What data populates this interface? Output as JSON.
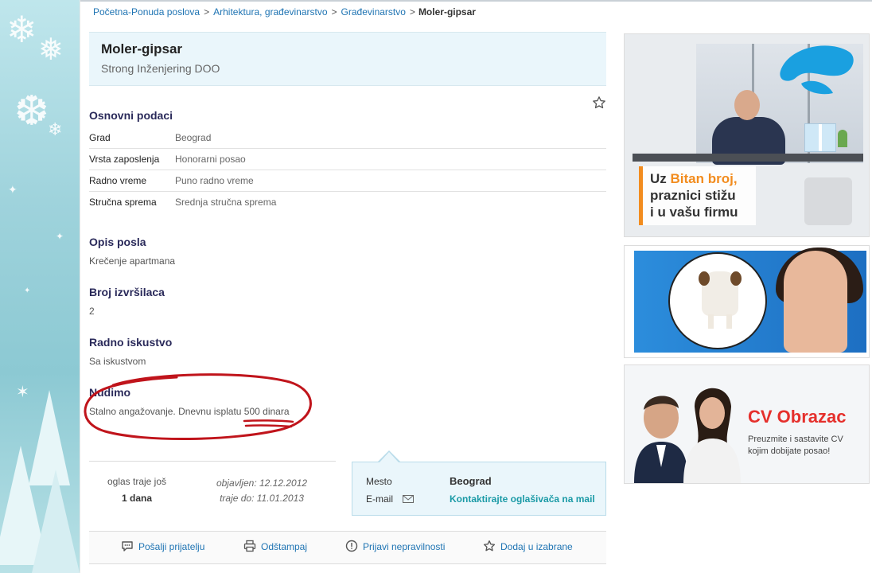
{
  "breadcrumb": {
    "items": [
      "Početna-Ponuda poslova",
      "Arhitektura, građevinarstvo",
      "Građevinarstvo"
    ],
    "separator": ">",
    "current": "Moler-gipsar"
  },
  "job": {
    "title": "Moler-gipsar",
    "company": "Strong Inženjering DOO"
  },
  "basic_info": {
    "title": "Osnovni podaci",
    "rows": [
      {
        "label": "Grad",
        "value": "Beograd"
      },
      {
        "label": "Vrsta zaposlenja",
        "value": "Honorarni posao"
      },
      {
        "label": "Radno vreme",
        "value": "Puno radno vreme"
      },
      {
        "label": "Stručna sprema",
        "value": "Srednja stručna sprema"
      }
    ]
  },
  "sections": {
    "description": {
      "title": "Opis posla",
      "text": "Krečenje apartmana"
    },
    "workers": {
      "title": "Broj izvršilaca",
      "text": "2"
    },
    "experience": {
      "title": "Radno iskustvo",
      "text": "Sa iskustvom"
    },
    "offer": {
      "title": "Nudimo",
      "text": "Stalno angažovanje. Dnevnu isplatu 500 dinara"
    }
  },
  "listing": {
    "duration_label": "oglas traje još",
    "duration_value": "1 dana",
    "published": "objavljen: 12.12.2012",
    "expires": "traje do: 11.01.2013"
  },
  "contact": {
    "place_label": "Mesto",
    "place_value": "Beograd",
    "email_label": "E-mail",
    "email_link": "Kontaktirajte oglašivača na mail"
  },
  "actions": [
    {
      "label": "Pošalji prijatelju",
      "icon": "speech-bubble-icon"
    },
    {
      "label": "Odštampaj",
      "icon": "printer-icon"
    },
    {
      "label": "Prijavi nepravilnosti",
      "icon": "warning-icon"
    },
    {
      "label": "Dodaj u izabrane",
      "icon": "star-icon"
    }
  ],
  "ads": {
    "ad1": {
      "line1_pre": "Uz ",
      "line1_highlight": "Bitan broj,",
      "line2": "praznici stižu",
      "line3": "i u vašu firmu"
    },
    "ad3": {
      "title": "CV Obrazac",
      "text": "Preuzmite i sastavite CV kojim dobijate posao!"
    }
  },
  "colors": {
    "link": "#1f74b3",
    "section_title": "#2a2a5a",
    "header_bg": "#eaf6fb",
    "annotation_red": "#c0141b",
    "ad_orange": "#f28c1e",
    "ad_red": "#e5302c"
  }
}
